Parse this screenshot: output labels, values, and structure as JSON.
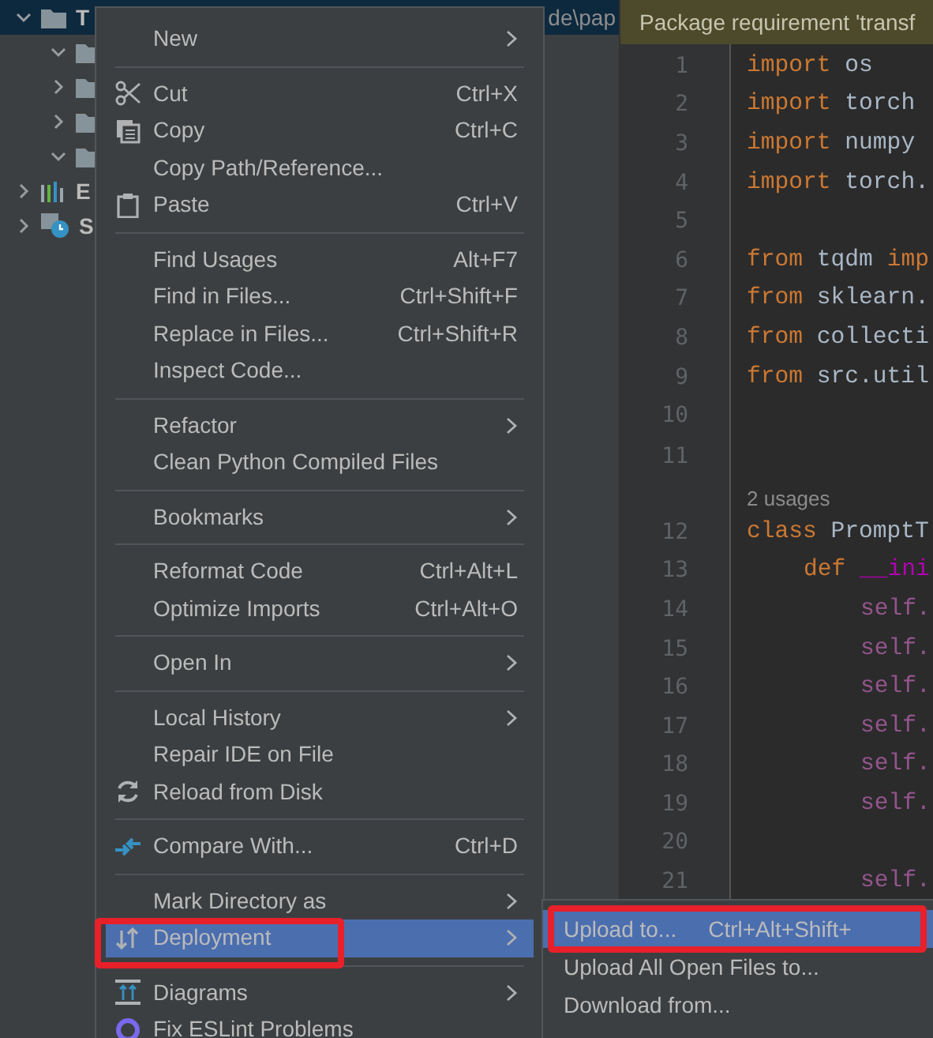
{
  "project_tree": {
    "rows": [
      {
        "label": "T",
        "path_tail": "de\\pap",
        "expanded": true,
        "selected": true,
        "kind": "folder",
        "children": [
          {
            "expanded": true,
            "selected": false,
            "kind": "folder"
          },
          {
            "expanded": false,
            "selected": false,
            "kind": "folder"
          },
          {
            "expanded": false,
            "selected": false,
            "kind": "folder"
          },
          {
            "expanded": true,
            "selected": false,
            "kind": "folder"
          }
        ]
      },
      {
        "label": "E",
        "expanded": false,
        "selected": false,
        "kind": "libraries"
      },
      {
        "label": "S",
        "expanded": false,
        "selected": false,
        "kind": "scratches"
      }
    ]
  },
  "editor": {
    "banner": "Package requirement 'transf",
    "lines": [
      {
        "number": "1",
        "kind": "top",
        "tokens": [
          {
            "kind": "keyword",
            "text": "import "
          },
          {
            "kind": "plain",
            "text": "os"
          }
        ]
      },
      {
        "number": "2",
        "kind": "top",
        "tokens": [
          {
            "kind": "keyword",
            "text": "import "
          },
          {
            "kind": "plain",
            "text": "torch"
          }
        ]
      },
      {
        "number": "3",
        "kind": "top",
        "tokens": [
          {
            "kind": "keyword",
            "text": "import "
          },
          {
            "kind": "plain",
            "text": "numpy"
          }
        ]
      },
      {
        "number": "4",
        "kind": "top",
        "tokens": [
          {
            "kind": "keyword",
            "text": "import "
          },
          {
            "kind": "plain",
            "text": "torch."
          }
        ]
      },
      {
        "number": "5",
        "kind": "top"
      },
      {
        "number": "6",
        "kind": "top",
        "tokens": [
          {
            "kind": "keyword",
            "text": "from "
          },
          {
            "kind": "plain",
            "text": "tqdm "
          },
          {
            "kind": "keyword",
            "text": "imp"
          }
        ]
      },
      {
        "number": "7",
        "kind": "top",
        "tokens": [
          {
            "kind": "keyword",
            "text": "from "
          },
          {
            "kind": "plain",
            "text": "sklearn."
          }
        ]
      },
      {
        "number": "8",
        "kind": "top",
        "tokens": [
          {
            "kind": "keyword",
            "text": "from "
          },
          {
            "kind": "plain",
            "text": "collecti"
          }
        ]
      },
      {
        "number": "9",
        "kind": "top",
        "tokens": [
          {
            "kind": "keyword",
            "text": "from "
          },
          {
            "kind": "plain",
            "text": "src.util"
          }
        ]
      },
      {
        "number": "10",
        "kind": "top"
      },
      {
        "number": "11",
        "kind": "top",
        "hint": "2 usages"
      },
      {
        "number": "12",
        "kind": "top",
        "tokens": [
          {
            "kind": "keyword",
            "text": "class "
          },
          {
            "kind": "plain",
            "text": "PromptT"
          }
        ]
      },
      {
        "number": "13",
        "kind": "method",
        "tokens": [
          {
            "kind": "keyword",
            "text": "def "
          },
          {
            "kind": "dunder",
            "text": "__ini"
          }
        ]
      },
      {
        "number": "14",
        "kind": "body",
        "tokens": [
          {
            "kind": "self",
            "text": "self."
          }
        ]
      },
      {
        "number": "15",
        "kind": "body",
        "tokens": [
          {
            "kind": "self",
            "text": "self."
          }
        ]
      },
      {
        "number": "16",
        "kind": "body",
        "tokens": [
          {
            "kind": "self",
            "text": "self."
          }
        ]
      },
      {
        "number": "17",
        "kind": "body",
        "tokens": [
          {
            "kind": "self",
            "text": "self."
          }
        ]
      },
      {
        "number": "18",
        "kind": "body",
        "tokens": [
          {
            "kind": "self",
            "text": "self."
          }
        ]
      },
      {
        "number": "19",
        "kind": "body",
        "tokens": [
          {
            "kind": "self",
            "text": "self."
          }
        ]
      },
      {
        "number": "20",
        "kind": "body"
      },
      {
        "number": "21",
        "kind": "body",
        "tokens": [
          {
            "kind": "self",
            "text": "self."
          }
        ]
      }
    ]
  },
  "context_menu": {
    "items": [
      {
        "kind": "plain",
        "label": "New",
        "submenu": true,
        "selected": false
      },
      {
        "kind": "separator"
      },
      {
        "kind": "cut",
        "label": "Cut",
        "shortcut": "Ctrl+X",
        "selected": false
      },
      {
        "kind": "copy",
        "label": "Copy",
        "shortcut": "Ctrl+C",
        "selected": false
      },
      {
        "kind": "plain",
        "label": "Copy Path/Reference...",
        "selected": false
      },
      {
        "kind": "paste",
        "label": "Paste",
        "shortcut": "Ctrl+V",
        "selected": false
      },
      {
        "kind": "separator"
      },
      {
        "kind": "plain",
        "label": "Find Usages",
        "shortcut": "Alt+F7",
        "selected": false
      },
      {
        "kind": "plain",
        "label": "Find in Files...",
        "shortcut": "Ctrl+Shift+F",
        "selected": false
      },
      {
        "kind": "plain",
        "label": "Replace in Files...",
        "shortcut": "Ctrl+Shift+R",
        "selected": false
      },
      {
        "kind": "plain",
        "label": "Inspect Code...",
        "selected": false
      },
      {
        "kind": "separator"
      },
      {
        "kind": "plain",
        "label": "Refactor",
        "submenu": true,
        "selected": false
      },
      {
        "kind": "plain",
        "label": "Clean Python Compiled Files",
        "selected": false
      },
      {
        "kind": "separator"
      },
      {
        "kind": "plain",
        "label": "Bookmarks",
        "submenu": true,
        "selected": false
      },
      {
        "kind": "separator"
      },
      {
        "kind": "plain",
        "label": "Reformat Code",
        "shortcut": "Ctrl+Alt+L",
        "selected": false
      },
      {
        "kind": "plain",
        "label": "Optimize Imports",
        "shortcut": "Ctrl+Alt+O",
        "selected": false
      },
      {
        "kind": "separator"
      },
      {
        "kind": "plain",
        "label": "Open In",
        "submenu": true,
        "selected": false
      },
      {
        "kind": "separator"
      },
      {
        "kind": "plain",
        "label": "Local History",
        "submenu": true,
        "selected": false
      },
      {
        "kind": "plain",
        "label": "Repair IDE on File",
        "selected": false
      },
      {
        "kind": "reload",
        "label": "Reload from Disk",
        "selected": false
      },
      {
        "kind": "separator"
      },
      {
        "kind": "compare",
        "label": "Compare With...",
        "shortcut": "Ctrl+D",
        "selected": false
      },
      {
        "kind": "separator"
      },
      {
        "kind": "plain",
        "label": "Mark Directory as",
        "submenu": true,
        "selected": false
      },
      {
        "kind": "deployment",
        "label": "Deployment",
        "submenu": true,
        "selected": true,
        "annotated": true
      },
      {
        "kind": "separator"
      },
      {
        "kind": "diagrams",
        "label": "Diagrams",
        "submenu": true,
        "selected": false
      },
      {
        "kind": "eslint",
        "label": "Fix ESLint Problems",
        "selected": false
      }
    ]
  },
  "submenu": {
    "items": [
      {
        "label": "Upload to...",
        "shortcut": "Ctrl+Alt+Shift+",
        "selected": true,
        "annotated": true
      },
      {
        "label": "Upload All Open Files to...",
        "selected": false,
        "annotated": false
      },
      {
        "label": "Download from...",
        "selected": false,
        "annotated": false
      }
    ]
  }
}
